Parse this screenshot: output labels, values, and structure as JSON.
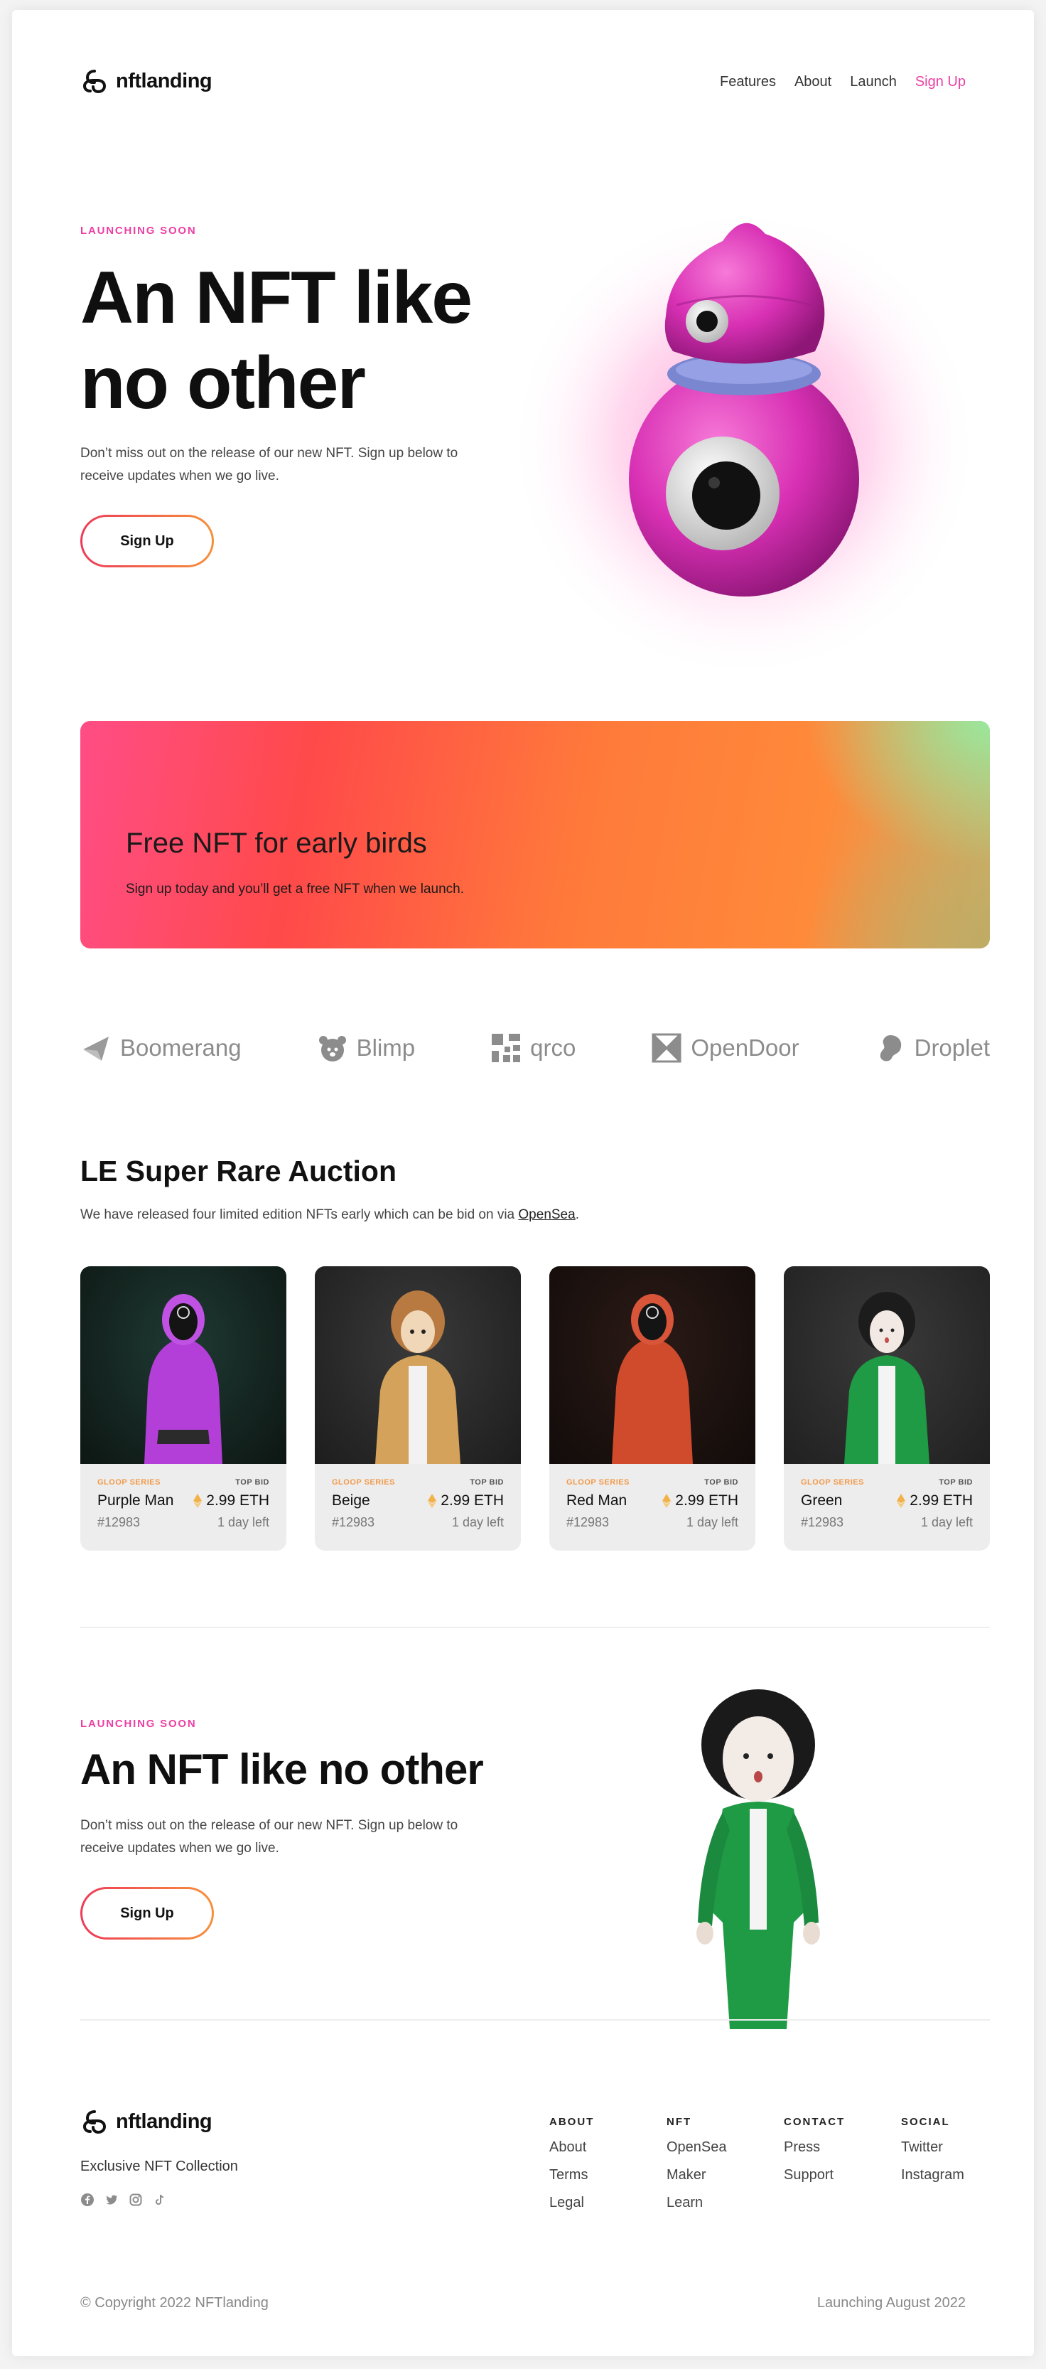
{
  "brand": {
    "name": "nftlanding"
  },
  "nav": {
    "features": "Features",
    "about": "About",
    "launch": "Launch",
    "signup": "Sign Up"
  },
  "hero": {
    "eyebrow": "LAUNCHING SOON",
    "title": "An NFT like no other",
    "desc": "Don’t miss out on the release of our new NFT. Sign up below to receive updates when we go live.",
    "button": "Sign Up"
  },
  "banner": {
    "title": "Free NFT for early birds",
    "subtitle": "Sign up today and you’ll get a free NFT when we launch."
  },
  "partners": [
    {
      "name": "Boomerang",
      "icon": "boomerang-icon"
    },
    {
      "name": "Blimp",
      "icon": "bear-icon"
    },
    {
      "name": "qrco",
      "icon": "qr-icon"
    },
    {
      "name": "OpenDoor",
      "icon": "door-icon"
    },
    {
      "name": "Droplet",
      "icon": "droplet-icon"
    }
  ],
  "auction": {
    "title": "LE Super Rare Auction",
    "desc_before": "We have released four limited edition NFTs early which can be bid on via ",
    "link": "OpenSea",
    "desc_after": ".",
    "cards": [
      {
        "series": "GLOOP SERIES",
        "label": "TOP BID",
        "name": "Purple Man",
        "price": "2.99 ETH",
        "id": "#12983",
        "time": "1 day left",
        "color": "#b23ad6"
      },
      {
        "series": "GLOOP SERIES",
        "label": "TOP BID",
        "name": "Beige",
        "price": "2.99 ETH",
        "id": "#12983",
        "time": "1 day left",
        "color": "#c9a05a"
      },
      {
        "series": "GLOOP SERIES",
        "label": "TOP BID",
        "name": "Red Man",
        "price": "2.99 ETH",
        "id": "#12983",
        "time": "1 day left",
        "color": "#d34a2a"
      },
      {
        "series": "GLOOP SERIES",
        "label": "TOP BID",
        "name": "Green",
        "price": "2.99 ETH",
        "id": "#12983",
        "time": "1 day left",
        "color": "#1f9a45"
      }
    ]
  },
  "cta": {
    "eyebrow": "LAUNCHING SOON",
    "title": "An NFT like no other",
    "desc": "Don’t miss out on the release of our new NFT. Sign up below to receive updates when we go live.",
    "button": "Sign Up"
  },
  "footer": {
    "tagline": "Exclusive NFT Collection",
    "socials": [
      "facebook-icon",
      "twitter-icon",
      "instagram-icon",
      "tiktok-icon"
    ],
    "columns": [
      {
        "title": "ABOUT",
        "links": [
          "About",
          "Terms",
          "Legal"
        ]
      },
      {
        "title": "NFT",
        "links": [
          "OpenSea",
          "Maker",
          "Learn"
        ]
      },
      {
        "title": "CONTACT",
        "links": [
          "Press",
          "Support"
        ]
      },
      {
        "title": "SOCIAL",
        "links": [
          "Twitter",
          "Instagram"
        ]
      }
    ],
    "copyright": "© Copyright 2022 NFTlanding",
    "launch_note": "Launching August 2022"
  },
  "colors": {
    "accent": "#ec3fa4",
    "gradient_start": "#ee3b58",
    "gradient_end": "#f6913b"
  }
}
